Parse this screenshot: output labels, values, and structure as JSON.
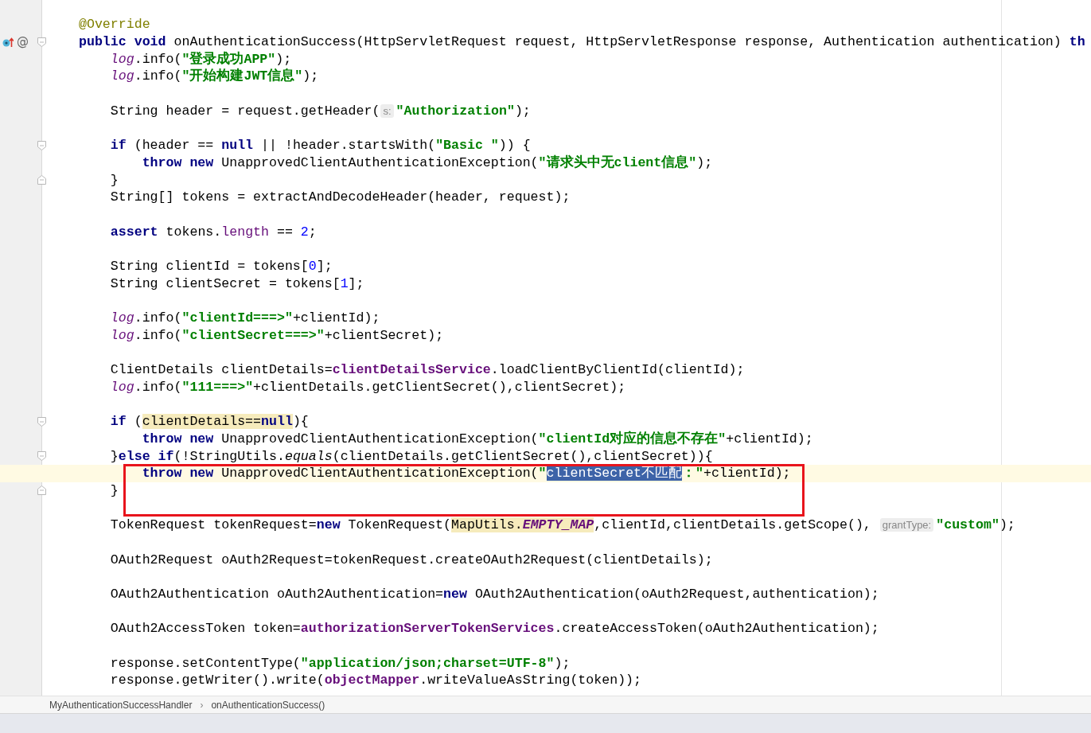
{
  "editor": {
    "lines": [
      {
        "kind": "code",
        "overrides": false,
        "fold_start": false,
        "fold_end": false,
        "tokens": [
          {
            "kind": "annot",
            "text": "@Override"
          }
        ]
      },
      {
        "kind": "code",
        "overrides": true,
        "gutter_text": "@",
        "fold_start": true,
        "fold_end": false,
        "tokens": [
          {
            "kind": "kw",
            "text": "public void"
          },
          {
            "kind": "plain",
            "text": " onAuthenticationSuccess(HttpServletRequest request, HttpServletResponse response, Authentication authentication) "
          },
          {
            "kind": "kw",
            "text": "th"
          }
        ]
      },
      {
        "kind": "code",
        "overrides": false,
        "fold_start": false,
        "fold_end": false,
        "tokens": [
          {
            "kind": "field",
            "text": "    log"
          },
          {
            "kind": "plain",
            "text": ".info("
          },
          {
            "kind": "str",
            "text": "\"登录成功APP\""
          },
          {
            "kind": "plain",
            "text": ");"
          }
        ]
      },
      {
        "kind": "code",
        "overrides": false,
        "fold_start": false,
        "fold_end": false,
        "tokens": [
          {
            "kind": "field",
            "text": "    log"
          },
          {
            "kind": "plain",
            "text": ".info("
          },
          {
            "kind": "str",
            "text": "\"开始构建JWT信息\""
          },
          {
            "kind": "plain",
            "text": ");"
          }
        ]
      },
      {
        "kind": "blank"
      },
      {
        "kind": "code",
        "overrides": false,
        "fold_start": false,
        "fold_end": false,
        "tokens": [
          {
            "kind": "plain",
            "text": "    String header = request.getHeader("
          },
          {
            "kind": "hint",
            "text": "s:"
          },
          {
            "kind": "str",
            "text": "\"Authorization\""
          },
          {
            "kind": "plain",
            "text": ");"
          }
        ]
      },
      {
        "kind": "blank"
      },
      {
        "kind": "code",
        "overrides": false,
        "fold_start": true,
        "fold_end": false,
        "tokens": [
          {
            "kind": "kw",
            "text": "    if"
          },
          {
            "kind": "plain",
            "text": " (header == "
          },
          {
            "kind": "kw",
            "text": "null"
          },
          {
            "kind": "plain",
            "text": " || !header.startsWith("
          },
          {
            "kind": "str",
            "text": "\"Basic \""
          },
          {
            "kind": "plain",
            "text": ")) {"
          }
        ]
      },
      {
        "kind": "code",
        "overrides": false,
        "fold_start": false,
        "fold_end": false,
        "tokens": [
          {
            "kind": "kw",
            "text": "        throw new"
          },
          {
            "kind": "plain",
            "text": " UnapprovedClientAuthenticationException("
          },
          {
            "kind": "str",
            "text": "\"请求头中无client信息\""
          },
          {
            "kind": "plain",
            "text": ");"
          }
        ]
      },
      {
        "kind": "code",
        "overrides": false,
        "fold_start": false,
        "fold_end": true,
        "tokens": [
          {
            "kind": "plain",
            "text": "    }"
          }
        ]
      },
      {
        "kind": "code",
        "overrides": false,
        "fold_start": false,
        "fold_end": false,
        "tokens": [
          {
            "kind": "plain",
            "text": "    String[] tokens = extractAndDecodeHeader(header, request);"
          }
        ]
      },
      {
        "kind": "blank"
      },
      {
        "kind": "code",
        "overrides": false,
        "fold_start": false,
        "fold_end": false,
        "tokens": [
          {
            "kind": "kw",
            "text": "    assert"
          },
          {
            "kind": "plain",
            "text": " tokens."
          },
          {
            "kind": "member",
            "text": "length"
          },
          {
            "kind": "plain",
            "text": " == "
          },
          {
            "kind": "num",
            "text": "2"
          },
          {
            "kind": "plain",
            "text": ";"
          }
        ]
      },
      {
        "kind": "blank"
      },
      {
        "kind": "code",
        "overrides": false,
        "fold_start": false,
        "fold_end": false,
        "tokens": [
          {
            "kind": "plain",
            "text": "    String clientId = tokens["
          },
          {
            "kind": "num",
            "text": "0"
          },
          {
            "kind": "plain",
            "text": "];"
          }
        ]
      },
      {
        "kind": "code",
        "overrides": false,
        "fold_start": false,
        "fold_end": false,
        "tokens": [
          {
            "kind": "plain",
            "text": "    String clientSecret = tokens["
          },
          {
            "kind": "num",
            "text": "1"
          },
          {
            "kind": "plain",
            "text": "];"
          }
        ]
      },
      {
        "kind": "blank"
      },
      {
        "kind": "code",
        "overrides": false,
        "fold_start": false,
        "fold_end": false,
        "tokens": [
          {
            "kind": "field",
            "text": "    log"
          },
          {
            "kind": "plain",
            "text": ".info("
          },
          {
            "kind": "str",
            "text": "\"clientId===>\""
          },
          {
            "kind": "plain",
            "text": "+clientId);"
          }
        ]
      },
      {
        "kind": "code",
        "overrides": false,
        "fold_start": false,
        "fold_end": false,
        "tokens": [
          {
            "kind": "field",
            "text": "    log"
          },
          {
            "kind": "plain",
            "text": ".info("
          },
          {
            "kind": "str",
            "text": "\"clientSecret===>\""
          },
          {
            "kind": "plain",
            "text": "+clientSecret);"
          }
        ]
      },
      {
        "kind": "blank"
      },
      {
        "kind": "code",
        "overrides": false,
        "fold_start": false,
        "fold_end": false,
        "tokens": [
          {
            "kind": "plain",
            "text": "    ClientDetails clientDetails="
          },
          {
            "kind": "fieldbold",
            "text": "clientDetailsService"
          },
          {
            "kind": "plain",
            "text": ".loadClientByClientId(clientId);"
          }
        ]
      },
      {
        "kind": "code",
        "overrides": false,
        "fold_start": false,
        "fold_end": false,
        "tokens": [
          {
            "kind": "field",
            "text": "    log"
          },
          {
            "kind": "plain",
            "text": ".info("
          },
          {
            "kind": "str",
            "text": "\"111===>\""
          },
          {
            "kind": "plain",
            "text": "+clientDetails.getClientSecret(),clientSecret);"
          }
        ]
      },
      {
        "kind": "blank"
      },
      {
        "kind": "code",
        "overrides": false,
        "fold_start": true,
        "fold_end": false,
        "tokens": [
          {
            "kind": "kw",
            "text": "    if"
          },
          {
            "kind": "plain",
            "text": " ("
          },
          {
            "kind": "plain",
            "text": "clientDetails==",
            "hl": true
          },
          {
            "kind": "kw",
            "text": "null",
            "hl": true
          },
          {
            "kind": "plain",
            "text": "){"
          }
        ]
      },
      {
        "kind": "code",
        "overrides": false,
        "fold_start": false,
        "fold_end": false,
        "tokens": [
          {
            "kind": "kw",
            "text": "        throw new"
          },
          {
            "kind": "plain",
            "text": " UnapprovedClientAuthenticationException("
          },
          {
            "kind": "str",
            "text": "\"clientId对应的信息不存在\""
          },
          {
            "kind": "plain",
            "text": "+clientId);"
          }
        ]
      },
      {
        "kind": "code",
        "overrides": false,
        "fold_start": true,
        "fold_end": false,
        "tokens": [
          {
            "kind": "plain",
            "text": "    }"
          },
          {
            "kind": "kw",
            "text": "else if"
          },
          {
            "kind": "plain",
            "text": "(!StringUtils."
          },
          {
            "kind": "static",
            "text": "equals"
          },
          {
            "kind": "plain",
            "text": "(clientDetails.getClientSecret(),clientSecret)){"
          }
        ]
      },
      {
        "kind": "code",
        "overrides": false,
        "fold_start": false,
        "fold_end": false,
        "current": true,
        "tokens": [
          {
            "kind": "kw",
            "text": "        throw new"
          },
          {
            "kind": "plain",
            "text": " UnapprovedClientAuthenticationException("
          },
          {
            "kind": "str",
            "text": "\""
          },
          {
            "kind": "selected",
            "text": "clientSecret不匹配"
          },
          {
            "kind": "str",
            "text": "：\""
          },
          {
            "kind": "plain",
            "text": "+clientId);"
          }
        ]
      },
      {
        "kind": "code",
        "overrides": false,
        "fold_start": false,
        "fold_end": true,
        "tokens": [
          {
            "kind": "plain",
            "text": "    }"
          }
        ]
      },
      {
        "kind": "blank"
      },
      {
        "kind": "code",
        "overrides": false,
        "fold_start": false,
        "fold_end": false,
        "tokens": [
          {
            "kind": "plain",
            "text": "    TokenRequest tokenRequest="
          },
          {
            "kind": "kw",
            "text": "new"
          },
          {
            "kind": "plain",
            "text": " TokenRequest("
          },
          {
            "kind": "plain",
            "text": "MapUtils.",
            "hl": true
          },
          {
            "kind": "const",
            "text": "EMPTY_MAP",
            "hl": true
          },
          {
            "kind": "plain",
            "text": ",clientId,clientDetails.getScope(), "
          },
          {
            "kind": "hint",
            "text": "grantType:"
          },
          {
            "kind": "str",
            "text": "\"custom\""
          },
          {
            "kind": "plain",
            "text": ");"
          }
        ]
      },
      {
        "kind": "blank"
      },
      {
        "kind": "code",
        "overrides": false,
        "fold_start": false,
        "fold_end": false,
        "tokens": [
          {
            "kind": "plain",
            "text": "    OAuth2Request oAuth2Request=tokenRequest.createOAuth2Request(clientDetails);"
          }
        ]
      },
      {
        "kind": "blank"
      },
      {
        "kind": "code",
        "overrides": false,
        "fold_start": false,
        "fold_end": false,
        "tokens": [
          {
            "kind": "plain",
            "text": "    OAuth2Authentication oAuth2Authentication="
          },
          {
            "kind": "kw",
            "text": "new"
          },
          {
            "kind": "plain",
            "text": " OAuth2Authentication(oAuth2Request,authentication);"
          }
        ]
      },
      {
        "kind": "blank"
      },
      {
        "kind": "code",
        "overrides": false,
        "fold_start": false,
        "fold_end": false,
        "tokens": [
          {
            "kind": "plain",
            "text": "    OAuth2AccessToken token="
          },
          {
            "kind": "fieldbold",
            "text": "authorizationServerTokenServices"
          },
          {
            "kind": "plain",
            "text": ".createAccessToken(oAuth2Authentication);"
          }
        ]
      },
      {
        "kind": "blank"
      },
      {
        "kind": "code",
        "overrides": false,
        "fold_start": false,
        "fold_end": false,
        "tokens": [
          {
            "kind": "plain",
            "text": "    response.setContentType("
          },
          {
            "kind": "str",
            "text": "\"application/json;charset=UTF-8\""
          },
          {
            "kind": "plain",
            "text": ");"
          }
        ]
      },
      {
        "kind": "code",
        "overrides": false,
        "fold_start": false,
        "fold_end": false,
        "tokens": [
          {
            "kind": "plain",
            "text": "    response.getWriter().write("
          },
          {
            "kind": "fieldbold",
            "text": "objectMapper"
          },
          {
            "kind": "plain",
            "text": ".writeValueAsString(token));"
          }
        ]
      }
    ]
  },
  "breadcrumb": [
    {
      "kind": "item",
      "text": "MyAuthenticationSuccessHandler"
    },
    {
      "kind": "sep",
      "text": "›"
    },
    {
      "kind": "item",
      "text": "onAuthenticationSuccess()"
    }
  ]
}
